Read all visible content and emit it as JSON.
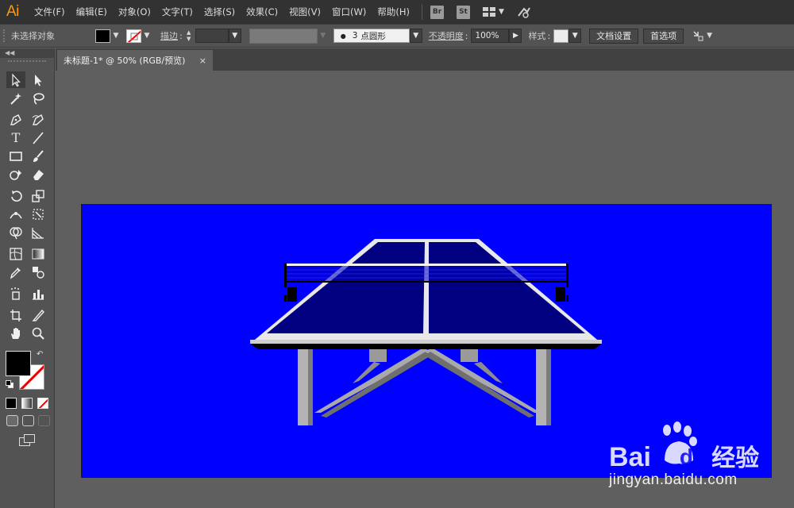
{
  "app": {
    "logo": "Ai"
  },
  "menus": [
    "文件(F)",
    "编辑(E)",
    "对象(O)",
    "文字(T)",
    "选择(S)",
    "效果(C)",
    "视图(V)",
    "窗口(W)",
    "帮助(H)"
  ],
  "app_badges": [
    "Br",
    "St"
  ],
  "control_bar": {
    "selection_status": "未选择对象",
    "stroke_label": "描边",
    "brush_size": "3",
    "brush_name": "点圆形",
    "opacity_label": "不透明度",
    "opacity_value": "100%",
    "style_label": "样式",
    "document_setup": "文档设置",
    "preferences": "首选项"
  },
  "document_tab": {
    "title": "未标题-1* @ 50% (RGB/预览)",
    "close": "×"
  },
  "watermark": {
    "brand_latin_1": "Bai",
    "brand_latin_2": "du",
    "brand_cn": "经验",
    "url": "jingyan.baidu.com"
  },
  "colors": {
    "artboard": "#0000ff",
    "table_top": "#000080",
    "menubar": "#323232",
    "panel": "#535353",
    "accent": "#ff9a00"
  }
}
